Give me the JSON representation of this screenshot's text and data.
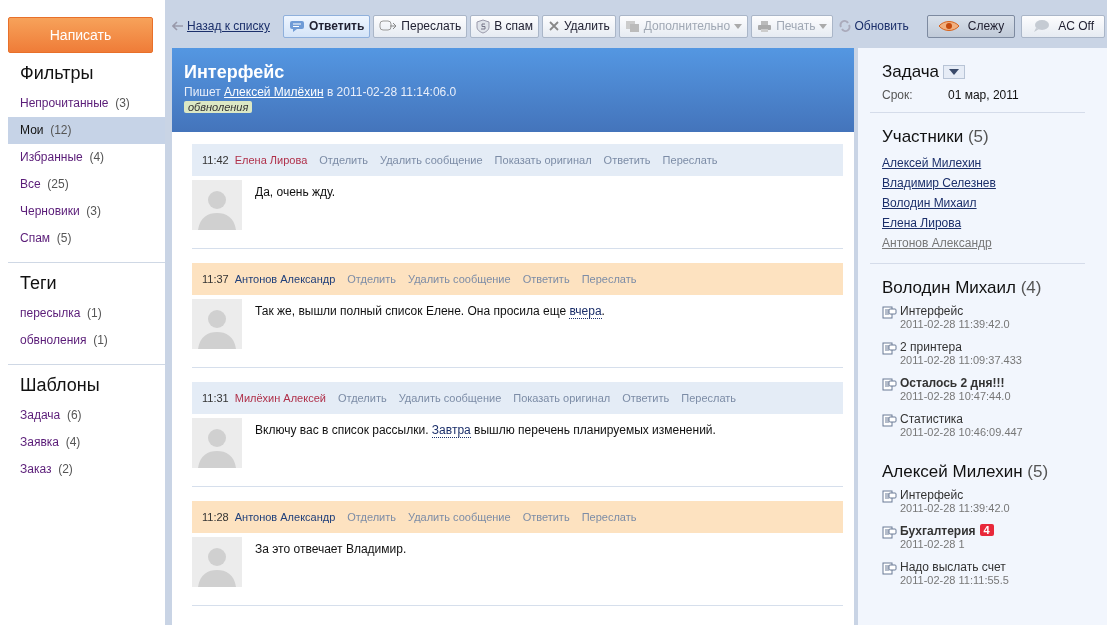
{
  "compose_button": "Написать",
  "sidebar": [
    {
      "title": "Фильтры",
      "items": [
        {
          "label": "Непрочитанные",
          "count": "(3)",
          "selected": false
        },
        {
          "label": "Мои",
          "count": "(12)",
          "selected": true
        },
        {
          "label": "Избранные",
          "count": "(4)",
          "selected": false
        },
        {
          "label": "Все",
          "count": "(25)",
          "selected": false
        },
        {
          "label": "Черновики",
          "count": "(3)",
          "selected": false
        },
        {
          "label": "Спам",
          "count": "(5)",
          "selected": false
        }
      ]
    },
    {
      "title": "Теги",
      "items": [
        {
          "label": "пересылка",
          "count": "(1)",
          "selected": false
        },
        {
          "label": "обвноления",
          "count": "(1)",
          "selected": false
        }
      ]
    },
    {
      "title": "Шаблоны",
      "items": [
        {
          "label": "Задача",
          "count": "(6)",
          "selected": false
        },
        {
          "label": "Заявка",
          "count": "(4)",
          "selected": false
        },
        {
          "label": "Заказ",
          "count": "(2)",
          "selected": false
        }
      ]
    }
  ],
  "toolbar": {
    "back": "Назад к списку",
    "buttons": [
      {
        "label": "Ответить",
        "kind": "reply",
        "selected": true,
        "disabled": false,
        "dropdown": false
      },
      {
        "label": "Переслать",
        "kind": "forward",
        "selected": false,
        "disabled": false,
        "dropdown": false
      },
      {
        "label": "В спам",
        "kind": "spam",
        "selected": false,
        "disabled": false,
        "dropdown": false
      },
      {
        "label": "Удалить",
        "kind": "delete",
        "selected": false,
        "disabled": false,
        "dropdown": false
      },
      {
        "label": "Дополнительно",
        "kind": "more",
        "selected": false,
        "disabled": true,
        "dropdown": true
      },
      {
        "label": "Печать",
        "kind": "print",
        "selected": false,
        "disabled": true,
        "dropdown": true
      }
    ],
    "refresh": "Обновить",
    "right_buttons": [
      {
        "label": "Слежу",
        "kind": "watch",
        "selected": true
      },
      {
        "label": "AC Off",
        "kind": "chat",
        "selected": false
      }
    ]
  },
  "thread": {
    "title": "Интерфейс",
    "by_prefix": "Пишет",
    "author": "Алексей Милёхин",
    "date_text": "в 2011-02-28 11:14:06.0",
    "tag": "обвноления"
  },
  "messages": [
    {
      "time": "11:42",
      "author": "Елена Лирова",
      "color": "#b0304a",
      "highlighted": false,
      "actions": [
        "Отделить",
        "Удалить сообщение",
        "Показать оригинал",
        "Ответить",
        "Переслать"
      ],
      "body": [
        {
          "kind": "text",
          "text": "Да, очень жду."
        }
      ]
    },
    {
      "time": "11:37",
      "author": "Антонов Александр",
      "color": "#1f3f7a",
      "highlighted": true,
      "actions": [
        "Отделить",
        "Удалить сообщение",
        "Ответить",
        "Переслать"
      ],
      "body": [
        {
          "kind": "text",
          "text": "Так же, вышли полный список Елене. Она просила еще "
        },
        {
          "kind": "link",
          "text": "вчера"
        },
        {
          "kind": "text",
          "text": "."
        }
      ]
    },
    {
      "time": "11:31",
      "author": "Милёхин Алексей",
      "color": "#b0304a",
      "highlighted": false,
      "actions": [
        "Отделить",
        "Удалить сообщение",
        "Показать оригинал",
        "Ответить",
        "Переслать"
      ],
      "body": [
        {
          "kind": "text",
          "text": "Включу вас в список рассылки. "
        },
        {
          "kind": "link",
          "text": "Завтра"
        },
        {
          "kind": "text",
          "text": " вышлю перечень планируемых изменений."
        }
      ]
    },
    {
      "time": "11:28",
      "author": "Антонов Александр",
      "color": "#1f3f7a",
      "highlighted": true,
      "actions": [
        "Отделить",
        "Удалить сообщение",
        "Ответить",
        "Переслать"
      ],
      "body": [
        {
          "kind": "text",
          "text": "За это отвечает Владимир."
        }
      ]
    }
  ],
  "task": {
    "title": "Задача",
    "deadline_label": "Срок:",
    "deadline": "01 мар, 2011"
  },
  "participants": {
    "title": "Участники",
    "count": "(5)",
    "people": [
      {
        "name": "Алексей Милехин",
        "disabled": false
      },
      {
        "name": "Владимир Селезнев",
        "disabled": false
      },
      {
        "name": "Володин Михаил",
        "disabled": false
      },
      {
        "name": "Елена Лирова",
        "disabled": false
      },
      {
        "name": "Антонов Александр",
        "disabled": true
      }
    ]
  },
  "related": [
    {
      "name": "Володин Михаил",
      "count": "(4)",
      "items": [
        {
          "title": "Интерфейс",
          "date": "2011-02-28 11:39:42.0",
          "unread": false
        },
        {
          "title": "2 принтера",
          "date": "2011-02-28 11:09:37.433",
          "unread": false
        },
        {
          "title": "Осталось 2 дня!!!",
          "date": "2011-02-28 10:47:44.0",
          "unread": true
        },
        {
          "title": "Статистика",
          "date": "2011-02-28 10:46:09.447",
          "unread": false
        }
      ]
    },
    {
      "name": "Алексей Милехин",
      "count": "(5)",
      "items": [
        {
          "title": "Интерфейс",
          "date": "2011-02-28 11:39:42.0",
          "unread": false
        },
        {
          "title": "Бухгалтерия",
          "badge": "4",
          "date": "2011-02-28 1",
          "unread": true
        },
        {
          "title": "Надо выслать счет",
          "date": "2011-02-28 11:11:55.5",
          "unread": false
        }
      ]
    }
  ]
}
